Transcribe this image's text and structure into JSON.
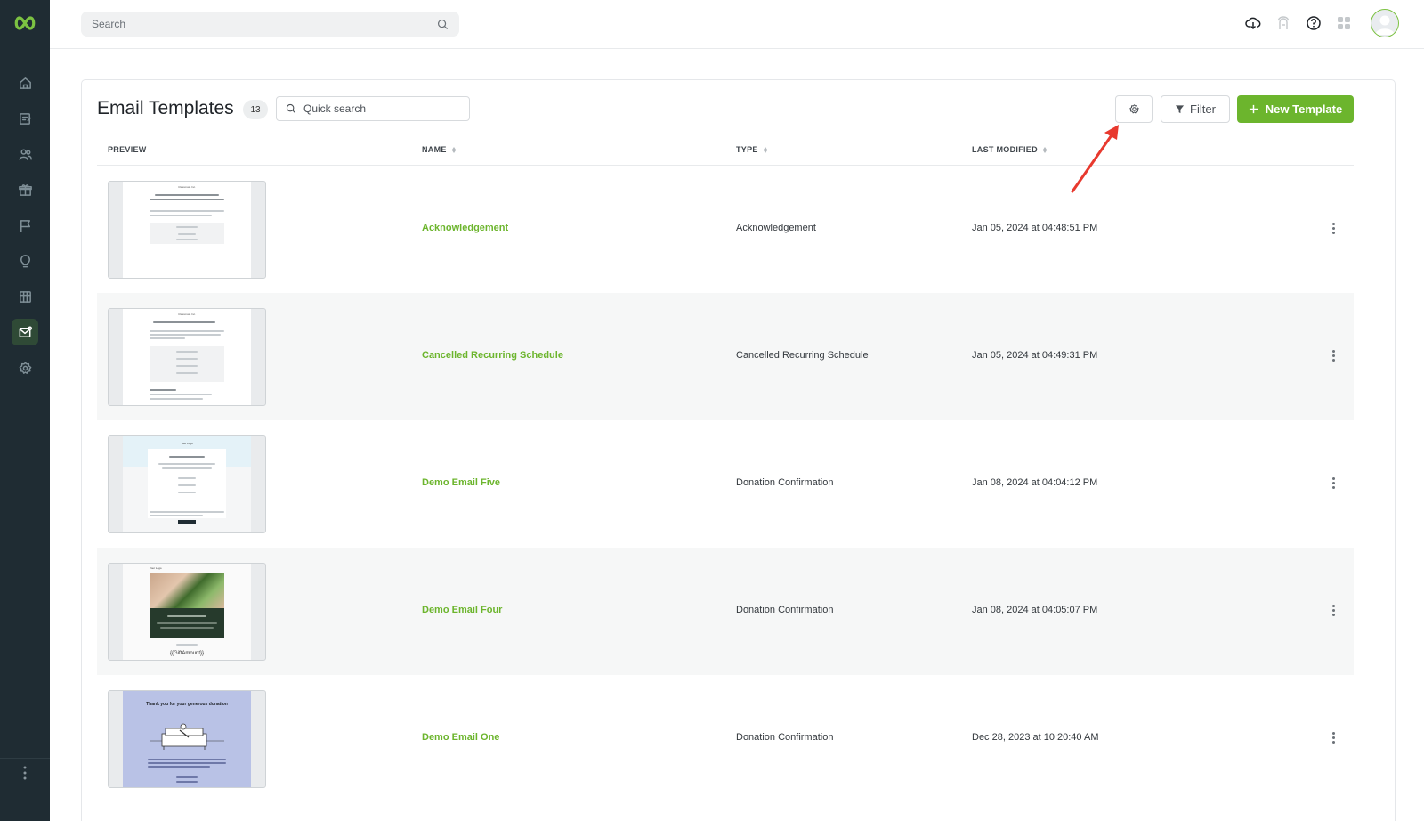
{
  "app": {
    "search_placeholder": "Search",
    "accent_color": "#6cb52d"
  },
  "sidebar": {
    "items": [
      {
        "icon": "home-icon",
        "active": false
      },
      {
        "icon": "edit-form-icon",
        "active": false
      },
      {
        "icon": "users-icon",
        "active": false
      },
      {
        "icon": "gift-icon",
        "active": false
      },
      {
        "icon": "flag-icon",
        "active": false
      },
      {
        "icon": "lightbulb-icon",
        "active": false
      },
      {
        "icon": "table-icon",
        "active": false
      },
      {
        "icon": "email-icon",
        "active": true
      },
      {
        "icon": "settings-icon",
        "active": false
      }
    ]
  },
  "topbar": {
    "icons": [
      "cloud-download-icon",
      "broadcast-icon",
      "help-icon",
      "apps-grid-icon",
      "user-avatar"
    ]
  },
  "page": {
    "title": "Email Templates",
    "count": "13",
    "quick_search_placeholder": "Quick search",
    "filter_label": "Filter",
    "new_template_label": "New Template"
  },
  "table": {
    "columns": [
      "PREVIEW",
      "NAME",
      "TYPE",
      "LAST MODIFIED"
    ],
    "rows": [
      {
        "name": "Acknowledgement",
        "type": "Acknowledgement",
        "modified": "Jan 05, 2024 at 04:48:51 PM",
        "preview": "plain"
      },
      {
        "name": "Cancelled Recurring Schedule",
        "type": "Cancelled Recurring Schedule",
        "modified": "Jan 05, 2024 at 04:49:31 PM",
        "preview": "plain"
      },
      {
        "name": "Demo Email Five",
        "type": "Donation Confirmation",
        "modified": "Jan 08, 2024 at 04:04:12 PM",
        "preview": "light-blue"
      },
      {
        "name": "Demo Email Four",
        "type": "Donation Confirmation",
        "modified": "Jan 08, 2024 at 04:05:07 PM",
        "preview": "photo"
      },
      {
        "name": "Demo Email One",
        "type": "Donation Confirmation",
        "modified": "Dec 28, 2023 at 10:20:40 AM",
        "preview": "lavender"
      }
    ]
  },
  "previews": {
    "thumb1_heading": "Classmate Inc.",
    "thumb2_heading": "Classmate Inc.",
    "thumb3_logo": "Your Logo",
    "thumb4_logo": "Your Logo",
    "thumb4_amount": "{{GiftAmount}}",
    "thumb5_heading": "Thank you for your generous donation"
  }
}
